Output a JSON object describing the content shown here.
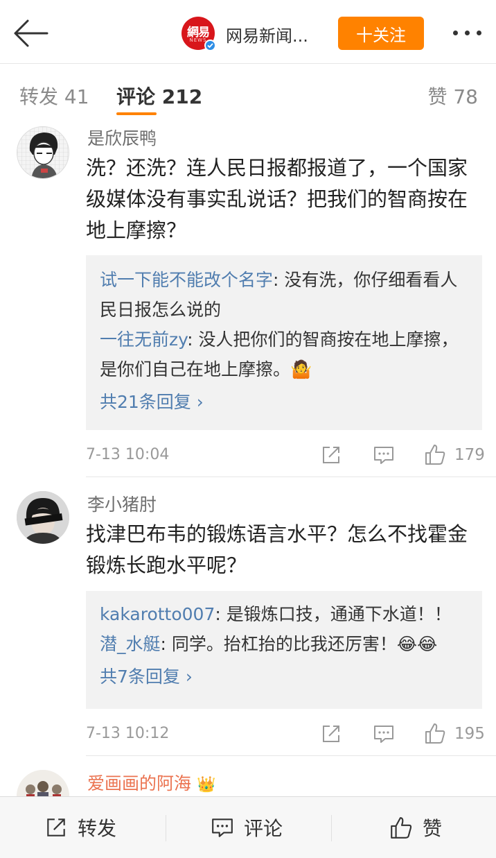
{
  "header": {
    "account_name": "网易新闻...",
    "logo_text": "網易",
    "logo_sub": "NEWS",
    "follow_label": "十关注"
  },
  "tabs": {
    "repost": "转发 41",
    "comments": "评论 212",
    "likes": "赞 78"
  },
  "comments": [
    {
      "user": "是欣辰鸭",
      "text": "洗？还洗？连人民日报都报道了，一个国家级媒体没有事实乱说话？把我们的智商按在地上摩擦？",
      "replies": [
        {
          "name": "试一下能不能改个名字",
          "text": ": 没有洗，你仔细看看人民日报怎么说的"
        },
        {
          "name": "一往无前zy",
          "text": ": 没人把你们的智商按在地上摩擦，是你们自己在地上摩擦。",
          "emoji": "🤷"
        }
      ],
      "more_replies": "共21条回复 ›",
      "time": "7-13 10:04",
      "likes": "179"
    },
    {
      "user": "李小猪肘",
      "text": "找津巴布韦的锻炼语言水平？怎么不找霍金锻炼长跑水平呢？",
      "replies": [
        {
          "name": "kakarotto007",
          "text": ": 是锻炼口技，通通下水道！！"
        },
        {
          "name": "潜_水艇",
          "text": ": 同学。抬杠抬的比我还厉害！",
          "emoji": "😂😂"
        }
      ],
      "more_replies": "共7条回复 ›",
      "time": "7-13 10:12",
      "likes": "195"
    },
    {
      "user": "爱画画的阿海",
      "badge": "👑"
    }
  ],
  "bottom_bar": {
    "repost": "转发",
    "comment": "评论",
    "like": "赞"
  },
  "colors": {
    "accent": "#ff8200",
    "link": "#507daf",
    "brand_red": "#d8161b",
    "vip_name": "#eb7350"
  }
}
